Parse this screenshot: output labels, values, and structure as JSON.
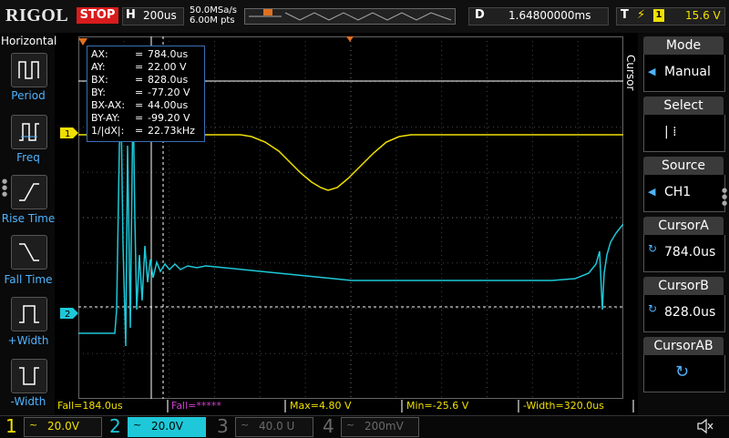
{
  "brand": "RIGOL",
  "run_state": "STOP",
  "horizontal": {
    "label": "H",
    "timebase": "200us",
    "sample_rate": "50.0MSa/s",
    "memory_depth": "6.00M pts"
  },
  "delay": {
    "label": "D",
    "value": "1.64800000ms"
  },
  "trigger": {
    "label": "T",
    "edge_symbol": "⚡",
    "source": "1",
    "level": "15.6 V"
  },
  "left_menu": {
    "title": "Horizontal",
    "items": [
      {
        "label": "Period"
      },
      {
        "label": "Freq"
      },
      {
        "label": "Rise Time"
      },
      {
        "label": "Fall Time"
      },
      {
        "label": "+Width"
      },
      {
        "label": "-Width"
      }
    ]
  },
  "cursor_readout": [
    {
      "key": "AX:",
      "value": "784.0us"
    },
    {
      "key": "AY:",
      "value": "22.00 V"
    },
    {
      "key": "BX:",
      "value": "828.0us"
    },
    {
      "key": "BY:",
      "value": "-77.20 V"
    },
    {
      "key": "BX-AX:",
      "value": "44.00us"
    },
    {
      "key": "BY-AY:",
      "value": "-99.20 V"
    },
    {
      "key": "1/|dX|:",
      "value": "22.73kHz"
    }
  ],
  "channel_markers": {
    "ch1": "1",
    "ch2": "2"
  },
  "measurements": [
    {
      "text": "Fall=184.0us",
      "color": "#f0e000"
    },
    {
      "text": "Fall=*****",
      "color": "#d040d0"
    },
    {
      "text": "Max=4.80 V",
      "color": "#f0e000"
    },
    {
      "text": "Min=-25.6 V",
      "color": "#f0e000"
    },
    {
      "text": "-Width=320.0us",
      "color": "#f0e000"
    }
  ],
  "channels": [
    {
      "num": "1",
      "coupling": "~",
      "scale": "20.0V",
      "color": "#f0e000",
      "active": true
    },
    {
      "num": "2",
      "coupling": "~",
      "scale": "20.0V",
      "color": "#1ec8d8",
      "active": true
    },
    {
      "num": "3",
      "coupling": "~",
      "scale": "40.0 U",
      "color": "#6a6a6a",
      "active": false
    },
    {
      "num": "4",
      "coupling": "~",
      "scale": "200mV",
      "color": "#6a6a6a",
      "active": false
    }
  ],
  "right_menu": {
    "vertical_title": "Cursor",
    "items": [
      {
        "title": "Mode",
        "value": "Manual",
        "icon": "left-arrow-icon"
      },
      {
        "title": "Select",
        "value": "|  ⁞",
        "icon": ""
      },
      {
        "title": "Source",
        "value": "CH1",
        "icon": "left-arrow-icon"
      },
      {
        "title": "CursorA",
        "value": "784.0us",
        "icon": "rotate-knob-icon"
      },
      {
        "title": "CursorB",
        "value": "828.0us",
        "icon": "rotate-knob-icon"
      },
      {
        "title": "CursorAB",
        "value": "",
        "icon": "rotate-knob-icon"
      }
    ]
  },
  "colors": {
    "ch1": "#f0e000",
    "ch2": "#1ec8d8",
    "accent": "#4fb3ff",
    "stop": "#d81c1c"
  }
}
